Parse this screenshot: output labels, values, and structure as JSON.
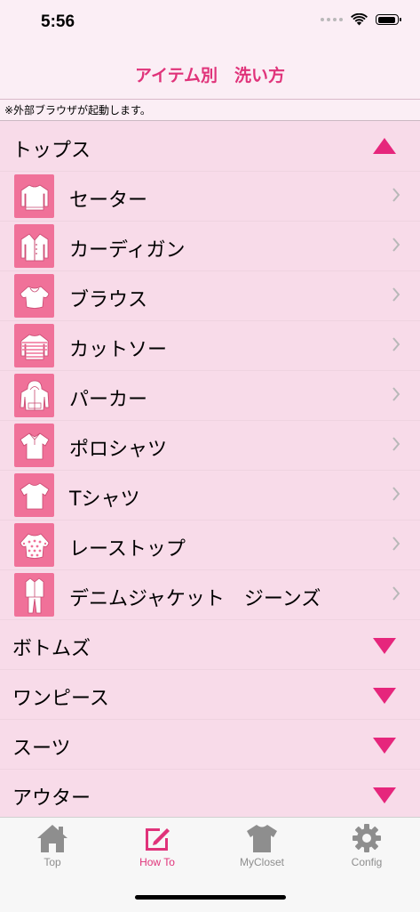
{
  "status_bar": {
    "time": "5:56"
  },
  "nav": {
    "title": "アイテム別　洗い方"
  },
  "notice": "※外部ブラウザが起動します。",
  "sections": {
    "tops": {
      "label": "トップス",
      "expanded": true,
      "items": [
        {
          "label": "セーター",
          "icon": "sweater-icon"
        },
        {
          "label": "カーディガン",
          "icon": "cardigan-icon"
        },
        {
          "label": "ブラウス",
          "icon": "blouse-icon"
        },
        {
          "label": "カットソー",
          "icon": "striped-shirt-icon"
        },
        {
          "label": "パーカー",
          "icon": "hoodie-icon"
        },
        {
          "label": "ポロシャツ",
          "icon": "polo-shirt-icon"
        },
        {
          "label": "Tシャツ",
          "icon": "tshirt-icon"
        },
        {
          "label": "レーストップ",
          "icon": "lace-top-icon"
        },
        {
          "label": "デニムジャケット　ジーンズ",
          "icon": "denim-icon"
        }
      ]
    },
    "bottoms": {
      "label": "ボトムズ",
      "expanded": false
    },
    "onepiece": {
      "label": "ワンピース",
      "expanded": false
    },
    "suits": {
      "label": "スーツ",
      "expanded": false
    },
    "outer": {
      "label": "アウター",
      "expanded": false
    }
  },
  "tabs": [
    {
      "label": "Top",
      "icon": "home-icon",
      "active": false
    },
    {
      "label": "How To",
      "icon": "edit-icon",
      "active": true
    },
    {
      "label": "MyCloset",
      "icon": "tshirt-icon",
      "active": false
    },
    {
      "label": "Config",
      "icon": "gear-icon",
      "active": false
    }
  ],
  "colors": {
    "accent": "#e0337a",
    "triangle": "#e6267c",
    "background": "#f8dbe9",
    "thumbnail": "#f07199"
  }
}
